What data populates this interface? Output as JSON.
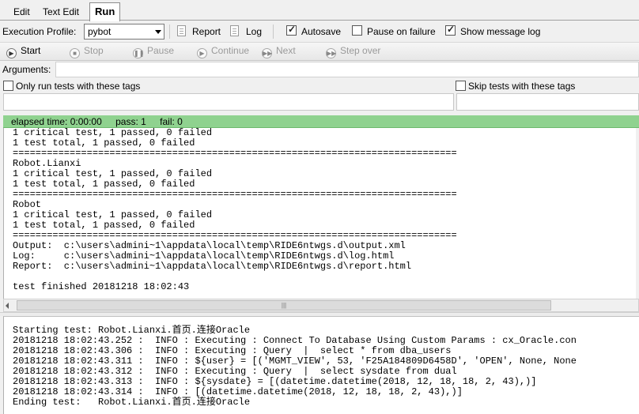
{
  "tabs": [
    {
      "label": "Edit"
    },
    {
      "label": "Text Edit"
    },
    {
      "label": "Run"
    }
  ],
  "profile": {
    "label": "Execution Profile:",
    "selected": "pybot",
    "report_label": "Report",
    "log_label": "Log",
    "autosave_label": "Autosave",
    "autosave_checked": true,
    "pause_on_failure_label": "Pause on failure",
    "pause_on_failure_checked": false,
    "show_message_log_label": "Show message log",
    "show_message_log_checked": true
  },
  "run_toolbar": {
    "start": "Start",
    "stop": "Stop",
    "pause": "Pause",
    "continue": "Continue",
    "next": "Next",
    "step_over": "Step over"
  },
  "arguments": {
    "label": "Arguments:",
    "value": ""
  },
  "tags": {
    "only_run_label": "Only run tests with these tags",
    "skip_label": "Skip tests with these tags"
  },
  "status": {
    "elapsed": "elapsed time: 0:00:00",
    "pass": "pass: 1",
    "fail": "fail: 0",
    "color": "#8fd28f"
  },
  "output_lines": [
    "1 critical test, 1 passed, 0 failed",
    "1 test total, 1 passed, 0 failed",
    "==============================================================================",
    "Robot.Lianxi",
    "1 critical test, 1 passed, 0 failed",
    "1 test total, 1 passed, 0 failed",
    "==============================================================================",
    "Robot",
    "1 critical test, 1 passed, 0 failed",
    "1 test total, 1 passed, 0 failed",
    "==============================================================================",
    "Output:  c:\\users\\admini~1\\appdata\\local\\temp\\RIDE6ntwgs.d\\output.xml",
    "Log:     c:\\users\\admini~1\\appdata\\local\\temp\\RIDE6ntwgs.d\\log.html",
    "Report:  c:\\users\\admini~1\\appdata\\local\\temp\\RIDE6ntwgs.d\\report.html",
    "",
    "test finished 20181218 18:02:43"
  ],
  "log_lines": [
    "Starting test: Robot.Lianxi.首页.连接Oracle",
    "20181218 18:02:43.252 :  INFO : Executing : Connect To Database Using Custom Params : cx_Oracle.con",
    "20181218 18:02:43.306 :  INFO : Executing : Query  |  select * from dba_users",
    "20181218 18:02:43.311 :  INFO : ${user} = [('MGMT_VIEW', 53, 'F25A184809D6458D', 'OPEN', None, None",
    "20181218 18:02:43.312 :  INFO : Executing : Query  |  select sysdate from dual",
    "20181218 18:02:43.313 :  INFO : ${sysdate} = [(datetime.datetime(2018, 12, 18, 18, 2, 43),)]",
    "20181218 18:02:43.314 :  INFO : [(datetime.datetime(2018, 12, 18, 18, 2, 43),)]",
    "Ending test:   Robot.Lianxi.首页.连接Oracle"
  ]
}
